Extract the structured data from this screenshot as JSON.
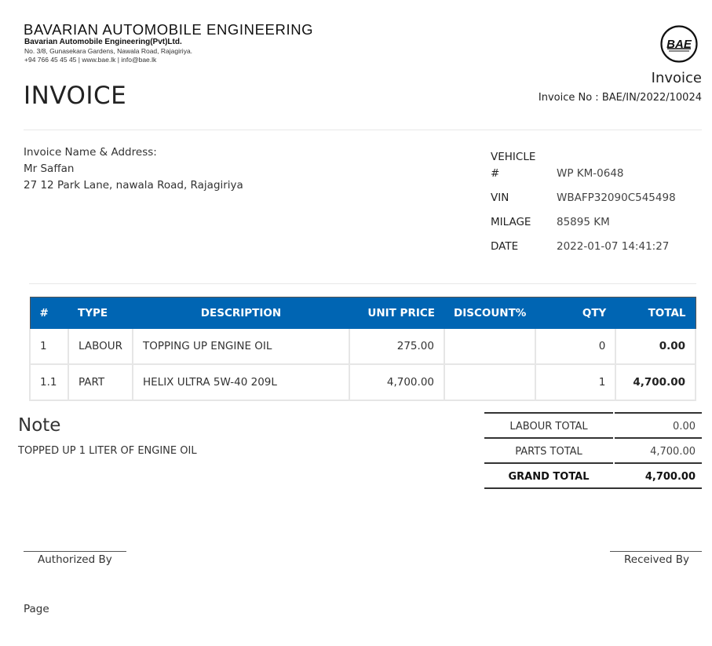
{
  "company": {
    "name": "BAVARIAN AUTOMOBILE ENGINEERING",
    "legal_name": "Bavarian Automobile Engineering(Pvt)Ltd.",
    "address": "No. 3/8, Gunasekara Gardens, Nawala Road, Rajagiriya.",
    "contact": "+94 766 45 45 45  |  www.bae.lk  |  info@bae.lk",
    "logo_text": "BAE"
  },
  "heading": "INVOICE",
  "header_right": {
    "title": "Invoice",
    "invoice_no": "Invoice No : BAE/IN/2022/10024"
  },
  "bill_to": {
    "label": "Invoice Name & Address:",
    "name": "Mr Saffan",
    "address": "27 12 Park Lane, nawala Road, Rajagiriya"
  },
  "vehicle": {
    "number_label_1": "VEHICLE",
    "number_label_2": "#",
    "number": "WP KM-0648",
    "vin_label": "VIN",
    "vin": "WBAFP32090C545498",
    "milage_label": "MILAGE",
    "milage": "85895 KM",
    "date_label": "DATE",
    "date": "2022-01-07 14:41:27"
  },
  "table": {
    "headers": [
      "#",
      "TYPE",
      "DESCRIPTION",
      "UNIT PRICE",
      "DISCOUNT%",
      "QTY",
      "TOTAL"
    ],
    "rows": [
      {
        "num": "1",
        "type": "LABOUR",
        "description": "TOPPING UP ENGINE OIL",
        "unit_price": "275.00",
        "discount": "",
        "qty": "0",
        "total": "0.00"
      },
      {
        "num": "1.1",
        "type": "PART",
        "description": "HELIX ULTRA 5W-40 209L",
        "unit_price": "4,700.00",
        "discount": "",
        "qty": "1",
        "total": "4,700.00"
      }
    ]
  },
  "note": {
    "title": "Note",
    "text": "TOPPED UP 1 LITER OF ENGINE OIL"
  },
  "totals": {
    "labour_label": "LABOUR TOTAL",
    "labour": "0.00",
    "parts_label": "PARTS TOTAL",
    "parts": "4,700.00",
    "grand_label": "GRAND TOTAL",
    "grand": "4,700.00"
  },
  "signatures": {
    "authorized": "Authorized By",
    "received": "Received By"
  },
  "footer": {
    "page": "Page"
  },
  "colors": {
    "table_header": "#0065b3"
  }
}
